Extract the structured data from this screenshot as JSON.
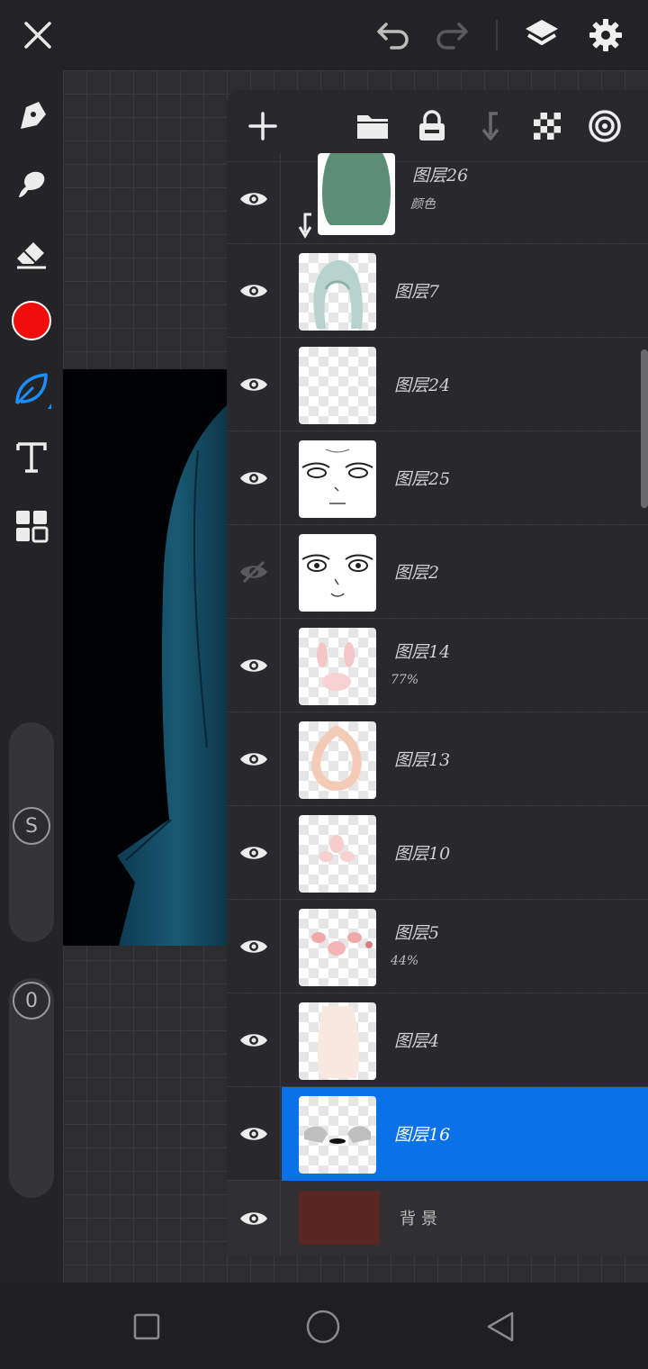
{
  "toolbar_top": {
    "close_icon": "close-icon",
    "undo_icon": "undo-icon",
    "redo_icon": "redo-icon",
    "layers_icon": "layers-icon",
    "settings_icon": "gear-icon"
  },
  "left_tools": [
    {
      "name": "pen-icon"
    },
    {
      "name": "smudge-icon"
    },
    {
      "name": "eraser-icon"
    },
    {
      "name": "color-swatch",
      "color": "#f20d0d"
    },
    {
      "name": "leaf-brush-icon"
    },
    {
      "name": "text-icon"
    },
    {
      "name": "grid-icon"
    }
  ],
  "sliders": {
    "size_label": "S",
    "opacity_label": "0"
  },
  "panel_tools": [
    "add-layer-icon",
    "folder-icon",
    "lock-icon",
    "clip-icon",
    "transparency-icon",
    "blend-icon"
  ],
  "layers": [
    {
      "name": "图层26",
      "sub": "颜色",
      "visible": true,
      "clipped": true
    },
    {
      "name": "图层7",
      "sub": "",
      "visible": true
    },
    {
      "name": "图层24",
      "sub": "",
      "visible": true
    },
    {
      "name": "图层25",
      "sub": "",
      "visible": true
    },
    {
      "name": "图层2",
      "sub": "",
      "visible": false
    },
    {
      "name": "图层14",
      "sub": "77%",
      "visible": true
    },
    {
      "name": "图层13",
      "sub": "",
      "visible": true
    },
    {
      "name": "图层10",
      "sub": "",
      "visible": true
    },
    {
      "name": "图层5",
      "sub": "44%",
      "visible": true
    },
    {
      "name": "图层4",
      "sub": "",
      "visible": true
    },
    {
      "name": "图层16",
      "sub": "",
      "visible": true,
      "selected": true
    },
    {
      "name": "背景",
      "sub": "",
      "visible": true,
      "background_color": "#5a2624"
    }
  ],
  "accent_color": "#0a72e8"
}
